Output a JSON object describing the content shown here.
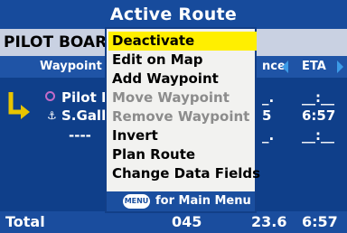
{
  "header": {
    "title": "Active Route"
  },
  "route": {
    "name": "PILOT BOARI"
  },
  "columns": {
    "waypoint": "Waypoint",
    "distance": "nce",
    "eta": "ETA"
  },
  "rows": [
    {
      "name": "Pilot E",
      "distance": "_.",
      "eta": "__:__"
    },
    {
      "name": "S.Gallc",
      "distance": "5",
      "eta": "6:57"
    },
    {
      "name": "----",
      "distance": "_.",
      "eta": "__:__"
    }
  ],
  "total": {
    "label": "Total",
    "course": "045",
    "distance": "23.6",
    "eta": "6:57"
  },
  "menu": {
    "items": [
      {
        "label": "Deactivate",
        "state": "selected"
      },
      {
        "label": "Edit on Map",
        "state": "enabled"
      },
      {
        "label": "Add Waypoint",
        "state": "enabled"
      },
      {
        "label": "Move Waypoint",
        "state": "disabled"
      },
      {
        "label": "Remove Waypoint",
        "state": "disabled"
      },
      {
        "label": "Invert",
        "state": "enabled"
      },
      {
        "label": "Plan Route",
        "state": "enabled"
      },
      {
        "label": "Change Data Fields",
        "state": "enabled"
      }
    ],
    "footer": {
      "button": "MENU",
      "text": "for Main Menu"
    }
  },
  "colors": {
    "title_bg": "#174b9c",
    "list_bg": "#0f3f8a",
    "menu_bg": "#f2f2f0",
    "selected_bg": "#ffef00",
    "disabled_text": "#8c8c8c"
  },
  "icons": [
    "route-turn-icon",
    "pilot-waypoint-icon",
    "anchor-waypoint-icon",
    "menu-button-icon",
    "left-arrow-icon",
    "right-arrow-icon"
  ]
}
